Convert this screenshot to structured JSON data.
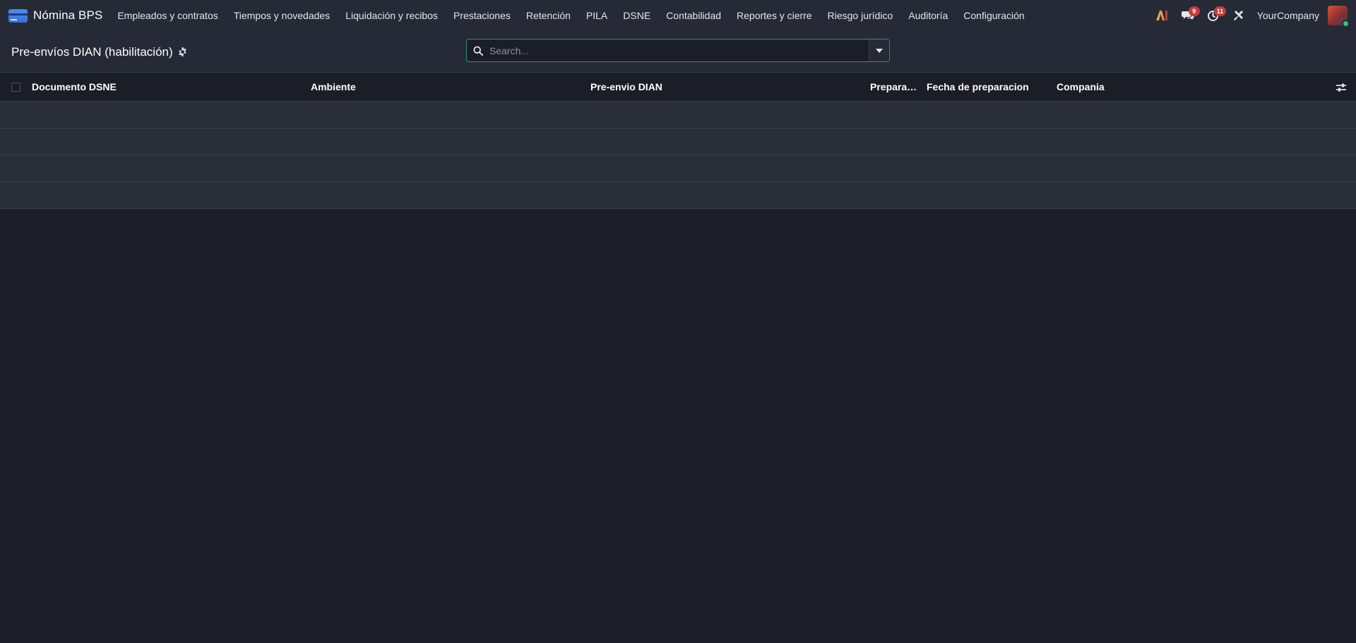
{
  "navbar": {
    "app_name": "Nómina BPS",
    "menu": [
      "Empleados y contratos",
      "Tiempos y novedades",
      "Liquidación y recibos",
      "Prestaciones",
      "Retención",
      "PILA",
      "DSNE",
      "Contabilidad",
      "Reportes y cierre",
      "Riesgo jurídico",
      "Auditoría",
      "Configuración"
    ],
    "ai_label": "AI",
    "messages_count": "9",
    "activities_count": "11",
    "company": "YourCompany",
    "colors": {
      "accent": "#2e8a80",
      "badge": "#c33b3b",
      "online": "#28c76f"
    }
  },
  "control_panel": {
    "title": "Pre-envíos DIAN (habilitación)",
    "search_placeholder": "Search..."
  },
  "list": {
    "columns": [
      "Documento DSNE",
      "Ambiente",
      "Pre-envio DIAN",
      "Preparaci...",
      "Fecha de preparacion",
      "Compania"
    ],
    "rows": [
      "",
      "",
      "",
      ""
    ]
  }
}
